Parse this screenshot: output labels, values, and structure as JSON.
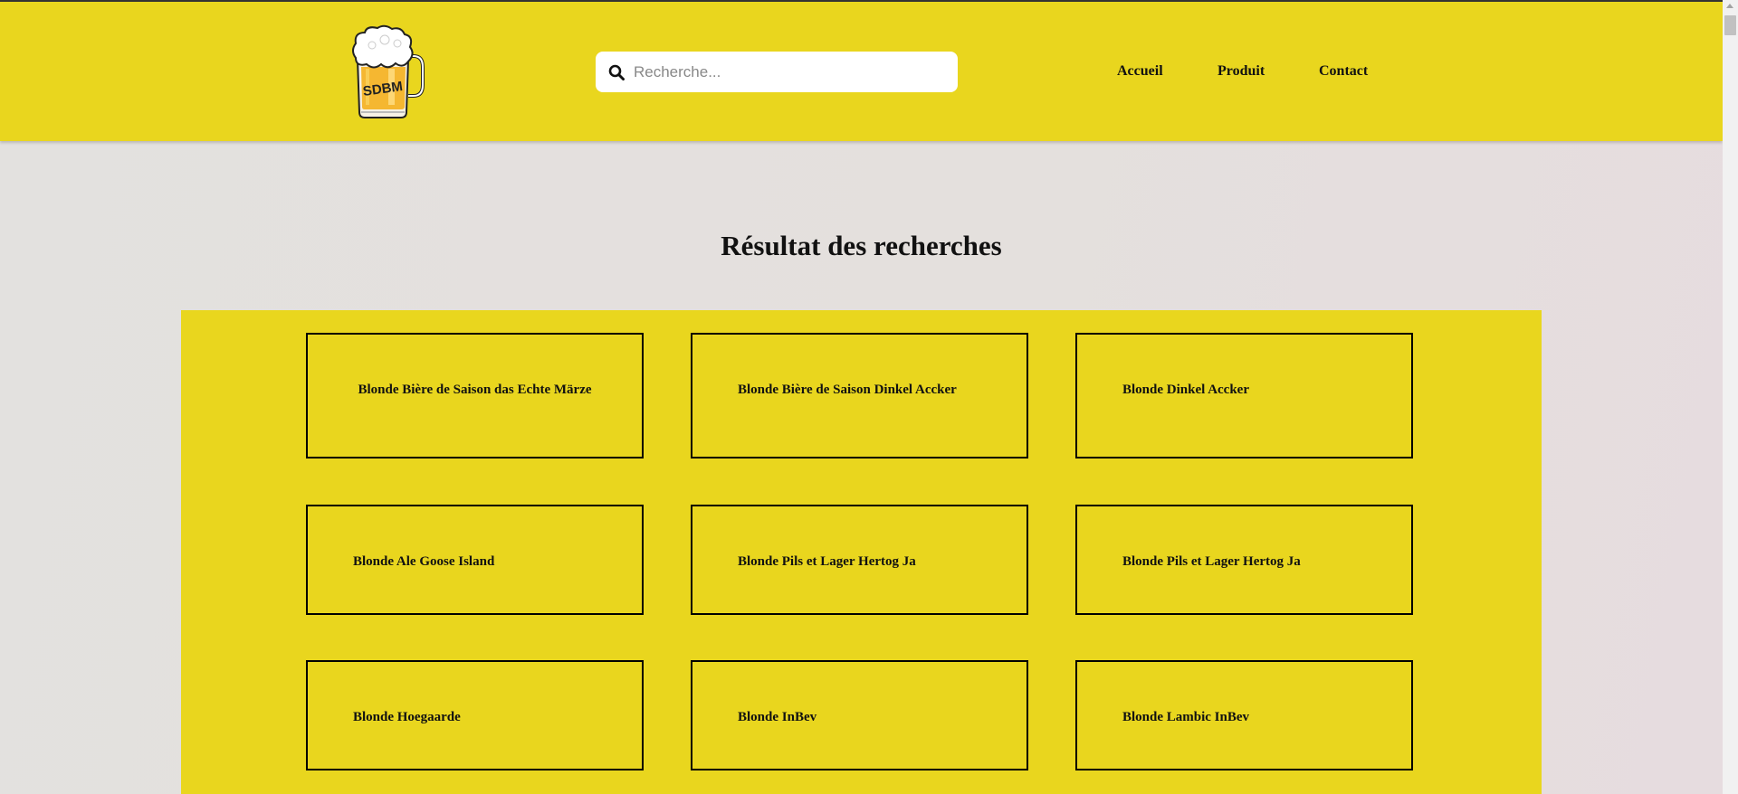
{
  "header": {
    "logo_text": "SDBM",
    "search": {
      "placeholder": "Recherche...",
      "value": ""
    },
    "nav": [
      "Accueil",
      "Produit",
      "Contact"
    ]
  },
  "main": {
    "title": "Résultat des recherches",
    "results": [
      "Blonde Bière de Saison das Echte Märze",
      "Blonde Bière de Saison Dinkel Accker",
      "Blonde Dinkel Accker",
      "Blonde Ale Goose Island",
      "Blonde Pils et Lager Hertog Ja",
      "Blonde Pils et Lager Hertog Ja",
      "Blonde Hoegaarde",
      "Blonde InBev",
      "Blonde Lambic InBev"
    ]
  },
  "colors": {
    "header_bg": "#e9d61e",
    "results_bg": "#e9d61e",
    "page_bg": "#e3e1df",
    "text": "#111111"
  },
  "icons": {
    "logo": "beer-mug-icon",
    "search": "search-icon"
  }
}
